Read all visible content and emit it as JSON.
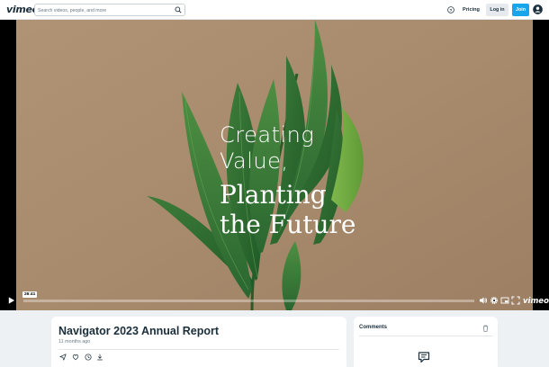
{
  "header": {
    "logo": "vimeo",
    "search_placeholder": "Search videos, people, and more",
    "pricing": "Pricing",
    "login": "Log in",
    "join": "Join",
    "icons": [
      "search-icon",
      "help-icon",
      "avatar-icon"
    ]
  },
  "player": {
    "overlay_line1": "Creating",
    "overlay_line2": "Value,",
    "overlay_line3": "Planting",
    "overlay_line4": "the Future",
    "time": "26:41",
    "progress_fraction": 0.0,
    "brand": "vimeo",
    "icons": [
      "play-icon",
      "volume-icon",
      "settings-icon",
      "pip-icon",
      "fullscreen-icon"
    ]
  },
  "video": {
    "title": "Navigator 2023 Annual Report",
    "meta": "11 months ago",
    "actions": [
      "share-icon",
      "like-icon",
      "watch-later-icon",
      "download-icon"
    ]
  },
  "comments": {
    "title": "Comments",
    "icons": [
      "trash-icon",
      "chat-icon"
    ]
  },
  "colors": {
    "accent": "#17a6ea",
    "text": "#1a2e3b",
    "page_bg": "#eef1f4",
    "video_bg": "#a8896a"
  }
}
